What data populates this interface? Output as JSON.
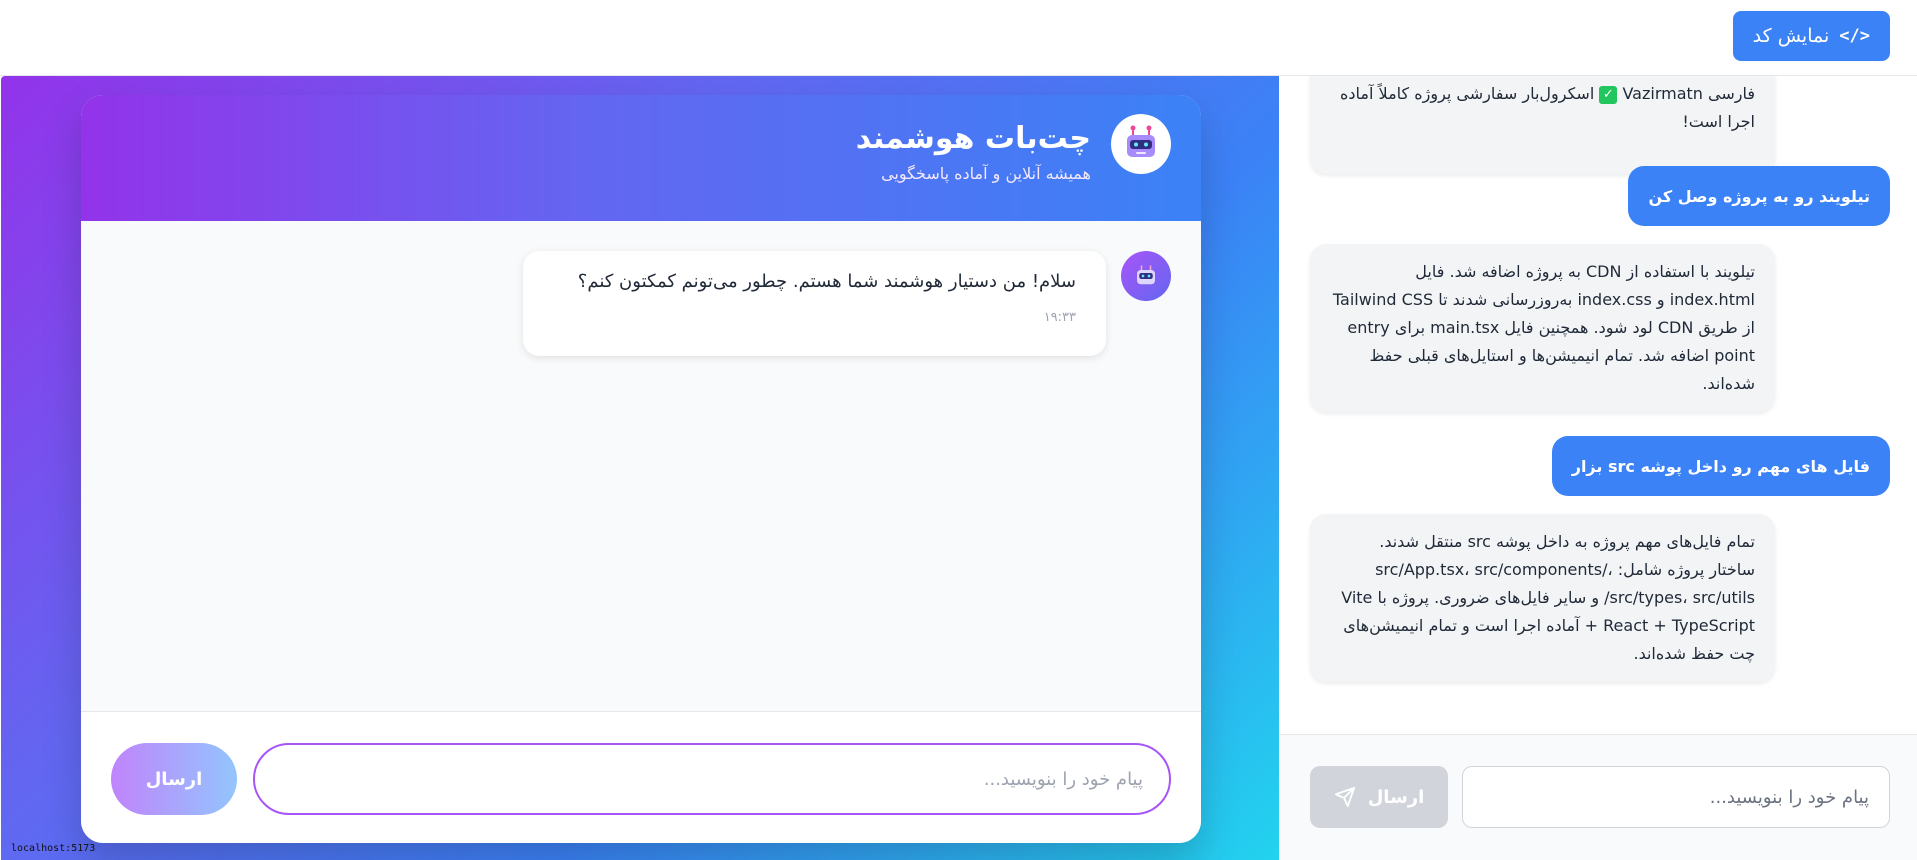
{
  "topbar": {
    "show_code_label": "نمایش کد",
    "show_code_icon": "</>"
  },
  "preview": {
    "header": {
      "title": "چت‌بات هوشمند",
      "subtitle": "همیشه آنلاین و آماده پاسخگویی",
      "avatar_icon": "robot-icon"
    },
    "messages": [
      {
        "sender": "bot",
        "text": "سلام! من دستیار هوشمند شما هستم. چطور می‌تونم کمکتون کنم؟",
        "time": "۱۹:۳۳"
      }
    ],
    "input_placeholder": "پیام خود را بنویسید...",
    "send_label": "ارسال",
    "url": "localhost:5173",
    "colors": {
      "gradient_start": "#9333ea",
      "gradient_mid": "#3b82f6",
      "gradient_end": "#22d3ee",
      "input_border": "#a855f7"
    }
  },
  "assistant": {
    "messages": [
      {
        "sender": "ai",
        "text_before": "فارسی Vazirmatn",
        "check": "✓",
        "text_after": "اسکرول‌بار سفارشی پروژه کاملاً آماده اجرا است!"
      },
      {
        "sender": "user",
        "text": "تیلویند رو به پروژه وصل کن"
      },
      {
        "sender": "ai",
        "text": "تیلویند با استفاده از CDN به پروژه اضافه شد. فایل index.html و index.css به‌روزرسانی شدند تا Tailwind CSS از طریق CDN لود شود. همچنین فایل main.tsx برای entry point اضافه شد. تمام انیمیشن‌ها و استایل‌های قبلی حفظ شده‌اند."
      },
      {
        "sender": "user",
        "text": "فایل های مهم رو داخل پوشه src بزار"
      },
      {
        "sender": "ai",
        "text": "تمام فایل‌های مهم پروژه به داخل پوشه src منتقل شدند. ساختار پروژه شامل: src/App.tsx، src/components/، src/types، src/utils/ و سایر فایل‌های ضروری. پروژه با Vite + React + TypeScript آماده اجرا است و تمام انیمیشن‌های چت حفظ شده‌اند."
      }
    ],
    "input_placeholder": "پیام خود را بنویسید...",
    "send_label": "ارسال",
    "send_icon": "paper-plane-icon",
    "colors": {
      "user_bubble": "#3b82f6",
      "ai_bubble": "#f3f4f6",
      "send_disabled": "#d1d5db"
    }
  }
}
